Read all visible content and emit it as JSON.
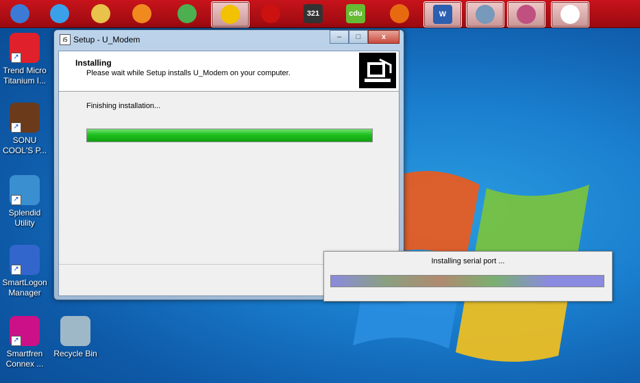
{
  "taskbar": {
    "items": [
      {
        "name": "start",
        "color": "#3b7bd6"
      },
      {
        "name": "internet-explorer",
        "color": "#3aa0ea"
      },
      {
        "name": "explorer",
        "color": "#e8c24a"
      },
      {
        "name": "media-player",
        "color": "#f08a1e"
      },
      {
        "name": "chrome",
        "color": "#4caf50"
      },
      {
        "name": "winamp",
        "color": "#f2c200"
      },
      {
        "name": "acrobat",
        "color": "#cc1111"
      },
      {
        "name": "media-player-classic",
        "color": "#333333",
        "label": "321"
      },
      {
        "name": "app-cdu",
        "color": "#66bb33",
        "label": "cdu"
      },
      {
        "name": "firefox",
        "color": "#e86a10"
      },
      {
        "name": "word",
        "color": "#2b5fb0",
        "label": "W"
      },
      {
        "name": "network",
        "color": "#7799bb"
      },
      {
        "name": "paint",
        "color": "#c05080"
      },
      {
        "name": "document",
        "color": "#ffffff"
      }
    ]
  },
  "desktop": {
    "icons": [
      {
        "label": "Trend Micro Titanium I...",
        "color": "#e0202a"
      },
      {
        "label": "SONU COOL'S P...",
        "color": "#6b3a1a"
      },
      {
        "label": "Splendid Utility",
        "color": "#3a8fd0"
      },
      {
        "label": "SmartLogon Manager",
        "color": "#3366cc"
      },
      {
        "label": "Smartfren Connex ...",
        "color": "#cc1188"
      },
      {
        "label": "Recycle Bin",
        "color": "#9fb8c8"
      }
    ]
  },
  "setup_window": {
    "title": "Setup - U_Modem",
    "minimize": "–",
    "maximize": "□",
    "close": "x",
    "header_title": "Installing",
    "header_subtitle": "Please wait while Setup installs U_Modem on your computer.",
    "status": "Finishing installation...",
    "progress": 1.0
  },
  "popup": {
    "text": "Installing serial port ...",
    "progress": 1.0
  }
}
